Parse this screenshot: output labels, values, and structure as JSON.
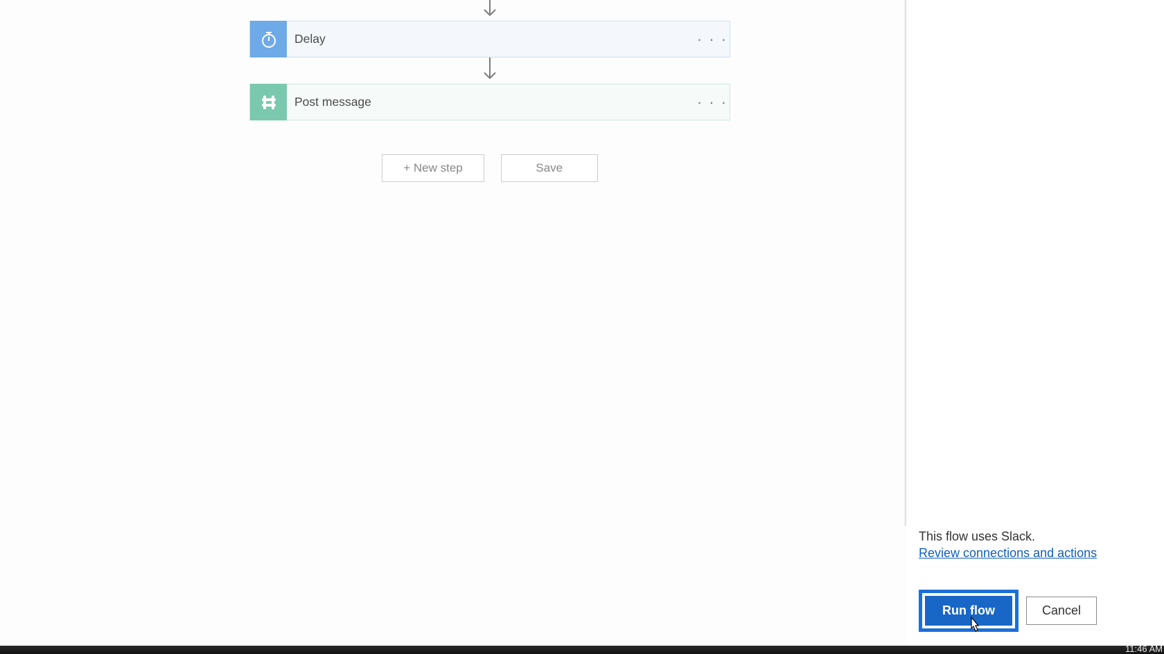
{
  "flow": {
    "steps": [
      {
        "label": "Delay",
        "icon": "timer"
      },
      {
        "label": "Post message",
        "icon": "slack"
      }
    ],
    "new_step_label": "+ New step",
    "save_label": "Save"
  },
  "panel": {
    "info_text": "This flow uses Slack.",
    "review_link": "Review connections and actions",
    "run_label": "Run flow",
    "cancel_label": "Cancel"
  },
  "taskbar": {
    "time": "11:46 AM"
  }
}
